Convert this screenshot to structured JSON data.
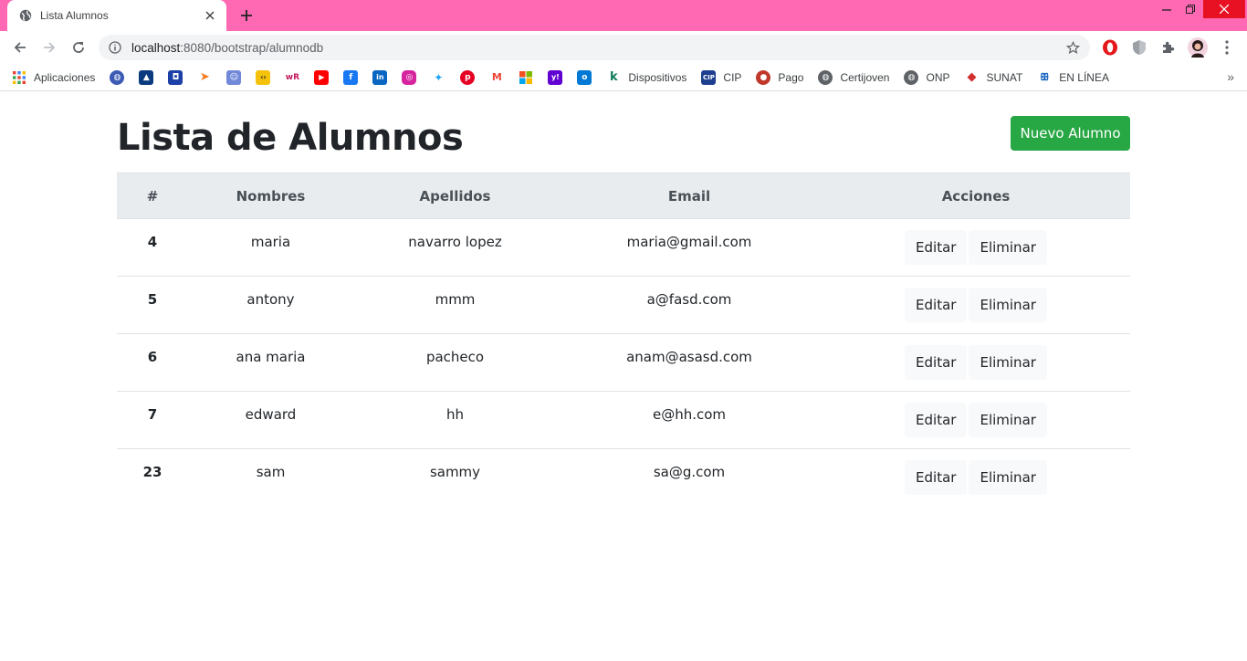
{
  "browser": {
    "tab_title": "Lista Alumnos",
    "url_host": "localhost",
    "url_rest": ":8080/bootstrap/alumnodb",
    "colors": {
      "tabstrip": "#ff69b4",
      "close_button": "#e81123"
    }
  },
  "bookmarks": {
    "apps_label": "Aplicaciones",
    "items": [
      {
        "label": "Dispositivos"
      },
      {
        "label": "CIP"
      },
      {
        "label": "Pago"
      },
      {
        "label": "Certijoven"
      },
      {
        "label": "ONP"
      },
      {
        "label": "SUNAT"
      },
      {
        "label": "EN LÍNEA"
      }
    ],
    "icon_only": [
      "globe-icon",
      "atlassian-icon",
      "box-icon",
      "arrow-icon",
      "discord-icon",
      "code-icon",
      "wr-icon",
      "youtube-icon",
      "facebook-icon",
      "linkedin-icon",
      "instagram-icon",
      "twitter-icon",
      "pinterest-icon",
      "gmail-icon",
      "microsoft-icon",
      "yahoo-icon",
      "outlook-icon"
    ],
    "more": "»"
  },
  "page": {
    "title": "Lista de Alumnos",
    "new_button": "Nuevo Alumno",
    "accent": "#28a745"
  },
  "table": {
    "headers": [
      "#",
      "Nombres",
      "Apellidos",
      "Email",
      "Acciones"
    ],
    "rows": [
      {
        "id": "4",
        "nombres": "maria",
        "apellidos": "navarro lopez",
        "email": "maria@gmail.com"
      },
      {
        "id": "5",
        "nombres": "antony",
        "apellidos": "mmm",
        "email": "a@fasd.com"
      },
      {
        "id": "6",
        "nombres": "ana maria",
        "apellidos": "pacheco",
        "email": "anam@asasd.com"
      },
      {
        "id": "7",
        "nombres": "edward",
        "apellidos": "hh",
        "email": "e@hh.com"
      },
      {
        "id": "23",
        "nombres": "sam",
        "apellidos": "sammy",
        "email": "sa@g.com"
      }
    ],
    "edit_label": "Editar",
    "delete_label": "Eliminar"
  }
}
